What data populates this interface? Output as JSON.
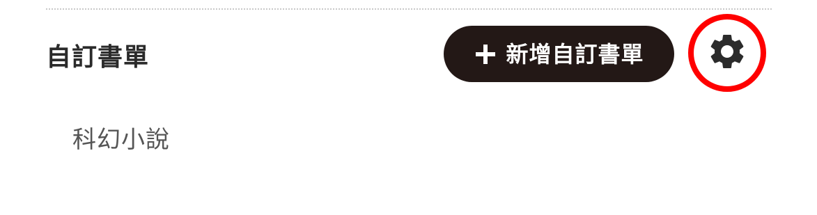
{
  "section": {
    "title": "自訂書單"
  },
  "toolbar": {
    "add_icon": "plus-icon",
    "add_label": "新增自訂書單",
    "settings_icon": "gear-icon"
  },
  "highlight": {
    "color": "#ff0000"
  },
  "colors": {
    "button_bg": "#231816",
    "title_text": "#2a2a2a",
    "list_text": "#555555"
  },
  "lists": [
    {
      "label": "科幻小說"
    }
  ]
}
